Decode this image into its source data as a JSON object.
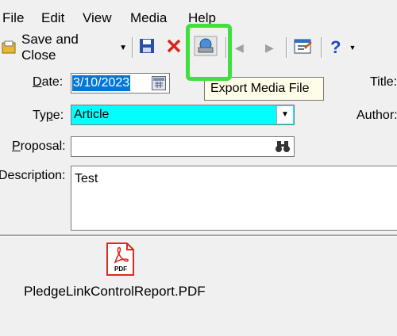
{
  "menu": {
    "items": [
      "File",
      "Edit",
      "View",
      "Media",
      "Help"
    ]
  },
  "toolbar": {
    "save_close_label": "Save and Close",
    "icons": [
      "save-icon",
      "delete-icon",
      "export-media-icon",
      "previous-icon",
      "next-icon",
      "properties-icon",
      "help-icon"
    ]
  },
  "tooltip": {
    "text": "Export Media File"
  },
  "form": {
    "date_label_prefix": "D",
    "date_label_rest": "ate:",
    "date_value": "3/10/2023",
    "type_label_prefix": "Ty",
    "type_label_u": "p",
    "type_label_rest": "e:",
    "type_value": "Article",
    "proposal_label_u": "P",
    "proposal_label_rest": "roposal:",
    "proposal_value": "",
    "description_label": "Description:",
    "description_value": "Test",
    "title_label": "Title:",
    "author_label": "Author:"
  },
  "attachment": {
    "filename": "PledgeLinkControlReport.PDF",
    "badge": "PDF"
  },
  "colors": {
    "type_field_bg": "#00ffff",
    "date_selected_bg": "#0078d7",
    "highlight": "#3ee03e",
    "pdf_red": "#e0281c"
  }
}
